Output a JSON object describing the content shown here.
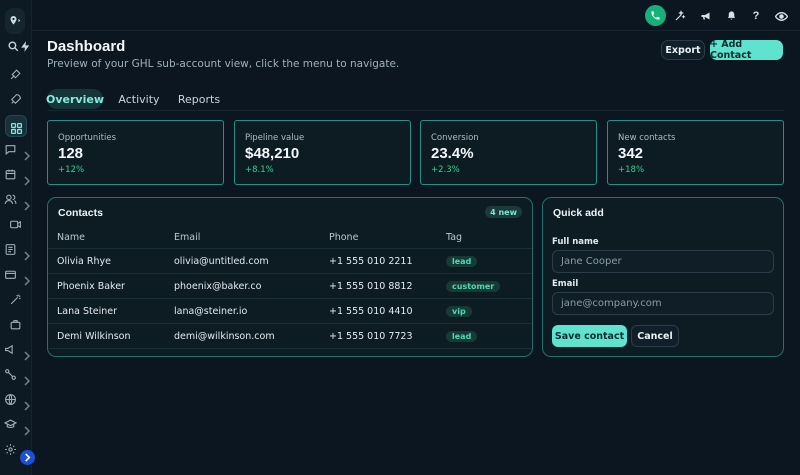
{
  "header": {
    "title": "Dashboard",
    "subtitle": "Preview of your GHL sub-account view, click the menu to navigate.",
    "export_label": "Export",
    "add_contact_label": "+ Add Contact"
  },
  "tabs": [
    {
      "label": "Overview",
      "active": true
    },
    {
      "label": "Activity",
      "active": false
    },
    {
      "label": "Reports",
      "active": false
    }
  ],
  "stats": [
    {
      "label": "Opportunities",
      "value": "128",
      "delta": "+12%"
    },
    {
      "label": "Pipeline value",
      "value": "$48,210",
      "delta": "+8.1%"
    },
    {
      "label": "Conversion",
      "value": "23.4%",
      "delta": "+2.3%"
    },
    {
      "label": "New contacts",
      "value": "342",
      "delta": "+18%"
    }
  ],
  "contacts": {
    "title": "Contacts",
    "badge": "4 new",
    "columns": [
      "Name",
      "Email",
      "Phone",
      "Tag"
    ],
    "rows": [
      {
        "name": "Olivia Rhye",
        "email": "olivia@untitled.com",
        "phone": "+1 555 010 2211",
        "tag": "lead"
      },
      {
        "name": "Phoenix Baker",
        "email": "phoenix@baker.co",
        "phone": "+1 555 010 8812",
        "tag": "customer"
      },
      {
        "name": "Lana Steiner",
        "email": "lana@steiner.io",
        "phone": "+1 555 010 4410",
        "tag": "vip"
      },
      {
        "name": "Demi Wilkinson",
        "email": "demi@wilkinson.com",
        "phone": "+1 555 010 7723",
        "tag": "lead"
      }
    ]
  },
  "quick_add": {
    "title": "Quick add",
    "full_name_label": "Full name",
    "full_name_placeholder": "Jane Cooper",
    "email_label": "Email",
    "email_placeholder": "jane@company.com",
    "save_label": "Save contact",
    "cancel_label": "Cancel"
  },
  "colors": {
    "accent": "#5fe3cf",
    "positive": "#33d28e",
    "card_border": "#2a8e88",
    "background": "#0b1620"
  },
  "icons": {
    "sidebar": [
      "location-icon",
      "search-icon",
      "bolt-icon",
      "launchpad-icon",
      "rocket-icon",
      "dashboard-icon",
      "conversations-icon",
      "calendar-icon",
      "contacts-icon",
      "video-icon",
      "forms-icon",
      "payments-icon",
      "ai-agents-icon",
      "marketplace-icon",
      "marketing-icon",
      "automation-icon",
      "sites-icon",
      "courses-icon",
      "settings-icon"
    ],
    "topbar": [
      "phone-icon",
      "magic-wand-icon",
      "megaphone-icon",
      "bell-icon",
      "help-icon",
      "eye-icon"
    ]
  }
}
